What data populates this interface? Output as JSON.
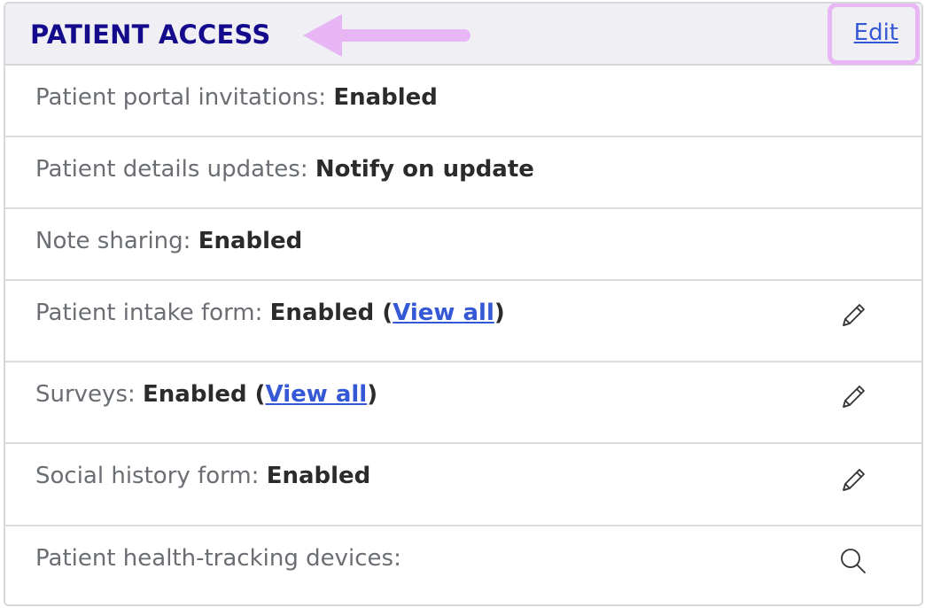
{
  "header": {
    "title": "PATIENT ACCESS",
    "edit_label": "Edit"
  },
  "rows": [
    {
      "label": "Patient portal invitations:",
      "value": "Enabled"
    },
    {
      "label": "Patient details updates:",
      "value": "Notify on update"
    },
    {
      "label": "Note sharing:",
      "value": "Enabled"
    },
    {
      "label": "Patient intake form:",
      "value": "Enabled",
      "link_open": " (",
      "link": "View all",
      "link_close": ")",
      "icon": "pencil-icon"
    },
    {
      "label": "Surveys:",
      "value": "Enabled",
      "link_open": " (",
      "link": "View all",
      "link_close": ")",
      "icon": "pencil-icon"
    },
    {
      "label": "Social history form:",
      "value": "Enabled",
      "icon": "pencil-icon"
    },
    {
      "label": "Patient health-tracking devices:",
      "value": "",
      "icon": "search-icon"
    }
  ],
  "colors": {
    "title": "#140a8c",
    "link": "#3558d6",
    "highlight": "#e8b6f4",
    "header_bg": "#f0f0f4"
  }
}
